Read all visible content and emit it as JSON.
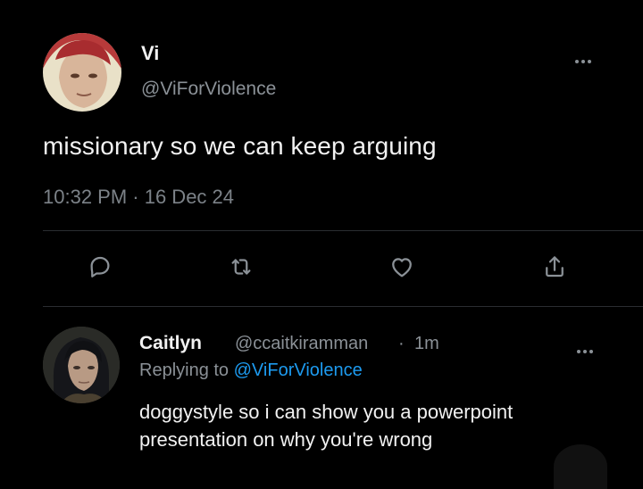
{
  "tweet": {
    "display_name": "Vi",
    "handle": "@ViForViolence",
    "text": "missionary so we can keep arguing",
    "timestamp": "10:32 PM · 16 Dec 24"
  },
  "actions": [
    {
      "icon": "reply-icon"
    },
    {
      "icon": "retweet-icon"
    },
    {
      "icon": "like-icon"
    },
    {
      "icon": "share-icon"
    }
  ],
  "reply": {
    "display_name": "Caitlyn",
    "handle": "@ccaitkiramman",
    "separator": "·",
    "time": "1m",
    "replying_prefix": "Replying to ",
    "replying_to": "@ViForViolence",
    "text": "doggystyle so i can show you a powerpoint presentation on why you're wrong"
  },
  "colors": {
    "background": "#000000",
    "link": "#1d9bf0",
    "muted": "#8b9197"
  }
}
